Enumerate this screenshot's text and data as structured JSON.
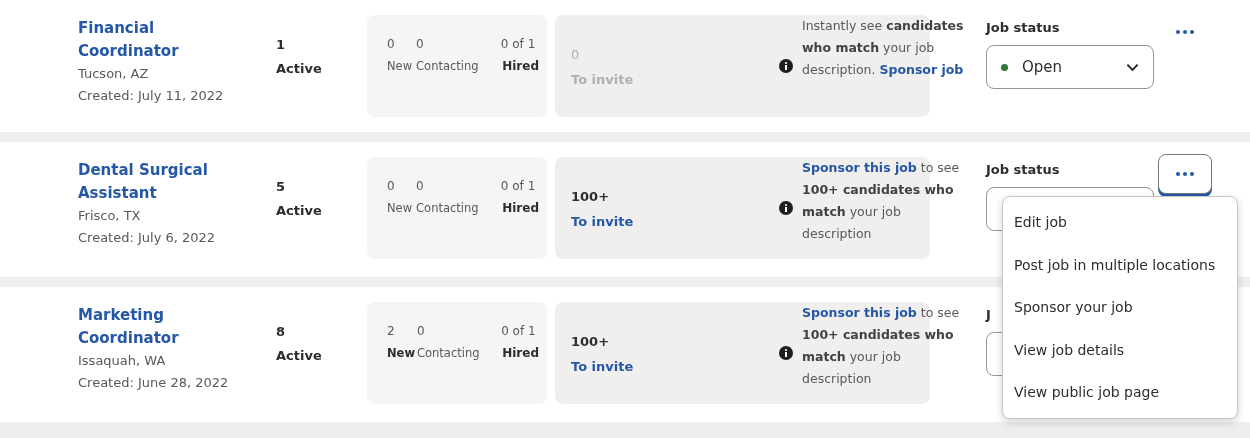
{
  "jobs": [
    {
      "title": "Financial Coordinator",
      "location": "Tucson, AZ",
      "created": "Created: July 11, 2022",
      "active_count": "1",
      "active_label": "Active",
      "stats": [
        {
          "value": "0",
          "label": "New",
          "bold": false
        },
        {
          "value": "0",
          "label": "Contacting",
          "bold": false
        },
        {
          "value": "0 of 1",
          "label": "Hired",
          "bold": true
        }
      ],
      "invite": {
        "value": "0",
        "label": "To invite",
        "disabled": true
      },
      "sponsor": [
        {
          "kind": "text",
          "text": "Instantly see **candidates who match** your job description. "
        },
        {
          "kind": "link",
          "text": "Sponsor job"
        }
      ],
      "status_label": "Job status",
      "status": {
        "value": "Open",
        "color": "#2d7a3a"
      },
      "menu_open": false
    },
    {
      "title": "Dental Surgical Assistant",
      "location": "Frisco, TX",
      "created": "Created: July 6, 2022",
      "active_count": "5",
      "active_label": "Active",
      "stats": [
        {
          "value": "0",
          "label": "New",
          "bold": false
        },
        {
          "value": "0",
          "label": "Contacting",
          "bold": false
        },
        {
          "value": "0 of 1",
          "label": "Hired",
          "bold": true
        }
      ],
      "invite": {
        "value": "100+",
        "label": "To invite",
        "disabled": false
      },
      "sponsor": [
        {
          "kind": "link",
          "text": "Sponsor this job"
        },
        {
          "kind": "text",
          "text": " to see **100+ candidates who match** your job description"
        }
      ],
      "status_label": "Job status",
      "menu_open": true
    },
    {
      "title": "Marketing Coordinator",
      "location": "Issaquah, WA",
      "created": "Created: June 28, 2022",
      "active_count": "8",
      "active_label": "Active",
      "stats": [
        {
          "value": "2",
          "label": "New",
          "bold": true
        },
        {
          "value": "0",
          "label": "Contacting",
          "bold": false
        },
        {
          "value": "0 of 1",
          "label": "Hired",
          "bold": true
        }
      ],
      "invite": {
        "value": "100+",
        "label": "To invite",
        "disabled": false
      },
      "sponsor": [
        {
          "kind": "link",
          "text": "Sponsor this job"
        },
        {
          "kind": "text",
          "text": " to see **100+ candidates who match** your job description"
        }
      ],
      "status_label": "J"
    }
  ],
  "menu": {
    "items": [
      "Edit job",
      "Post job in multiple locations",
      "Sponsor your job",
      "View job details",
      "View public job page"
    ]
  }
}
